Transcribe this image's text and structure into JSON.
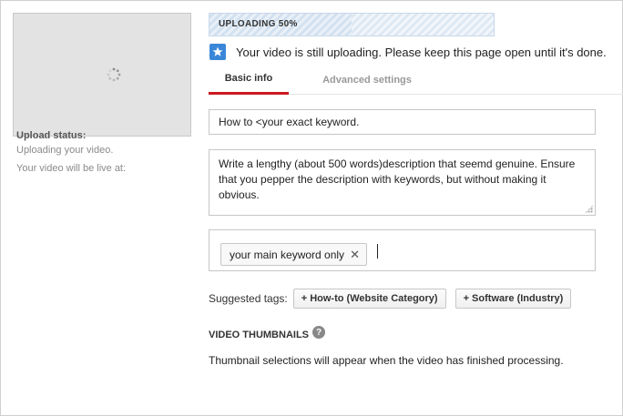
{
  "upload": {
    "progress_label": "UPLOADING 50%",
    "progress_fraction": 0.5,
    "notice": "Your video is still uploading. Please keep this page open until it's done.",
    "notice_icon": "star-icon"
  },
  "left_panel": {
    "status_label": "Upload status:",
    "status_line1": "Uploading your video.",
    "status_line2": "Your video will be live at:"
  },
  "tabs": [
    {
      "label": "Basic info",
      "active": true
    },
    {
      "label": "Advanced settings",
      "active": false
    }
  ],
  "form": {
    "title_value": "How to <your exact keyword.",
    "description_value": "Write a lengthy (about 500 words)description that seemd genuine. Ensure that you pepper the description with keywords, but without making it obvious.",
    "tags": [
      {
        "label": "your main keyword only",
        "remove_symbol": "✕"
      }
    ]
  },
  "suggested_tags": {
    "label": "Suggested tags:",
    "items": [
      {
        "label": "+ How-to (Website Category)"
      },
      {
        "label": "+ Software (Industry)"
      }
    ]
  },
  "thumbnails": {
    "heading": "VIDEO THUMBNAILS",
    "help_symbol": "?",
    "note": "Thumbnail selections will appear when the video has finished processing."
  },
  "colors": {
    "accent_red": "#cc181e",
    "notice_blue": "#3a87d8"
  }
}
